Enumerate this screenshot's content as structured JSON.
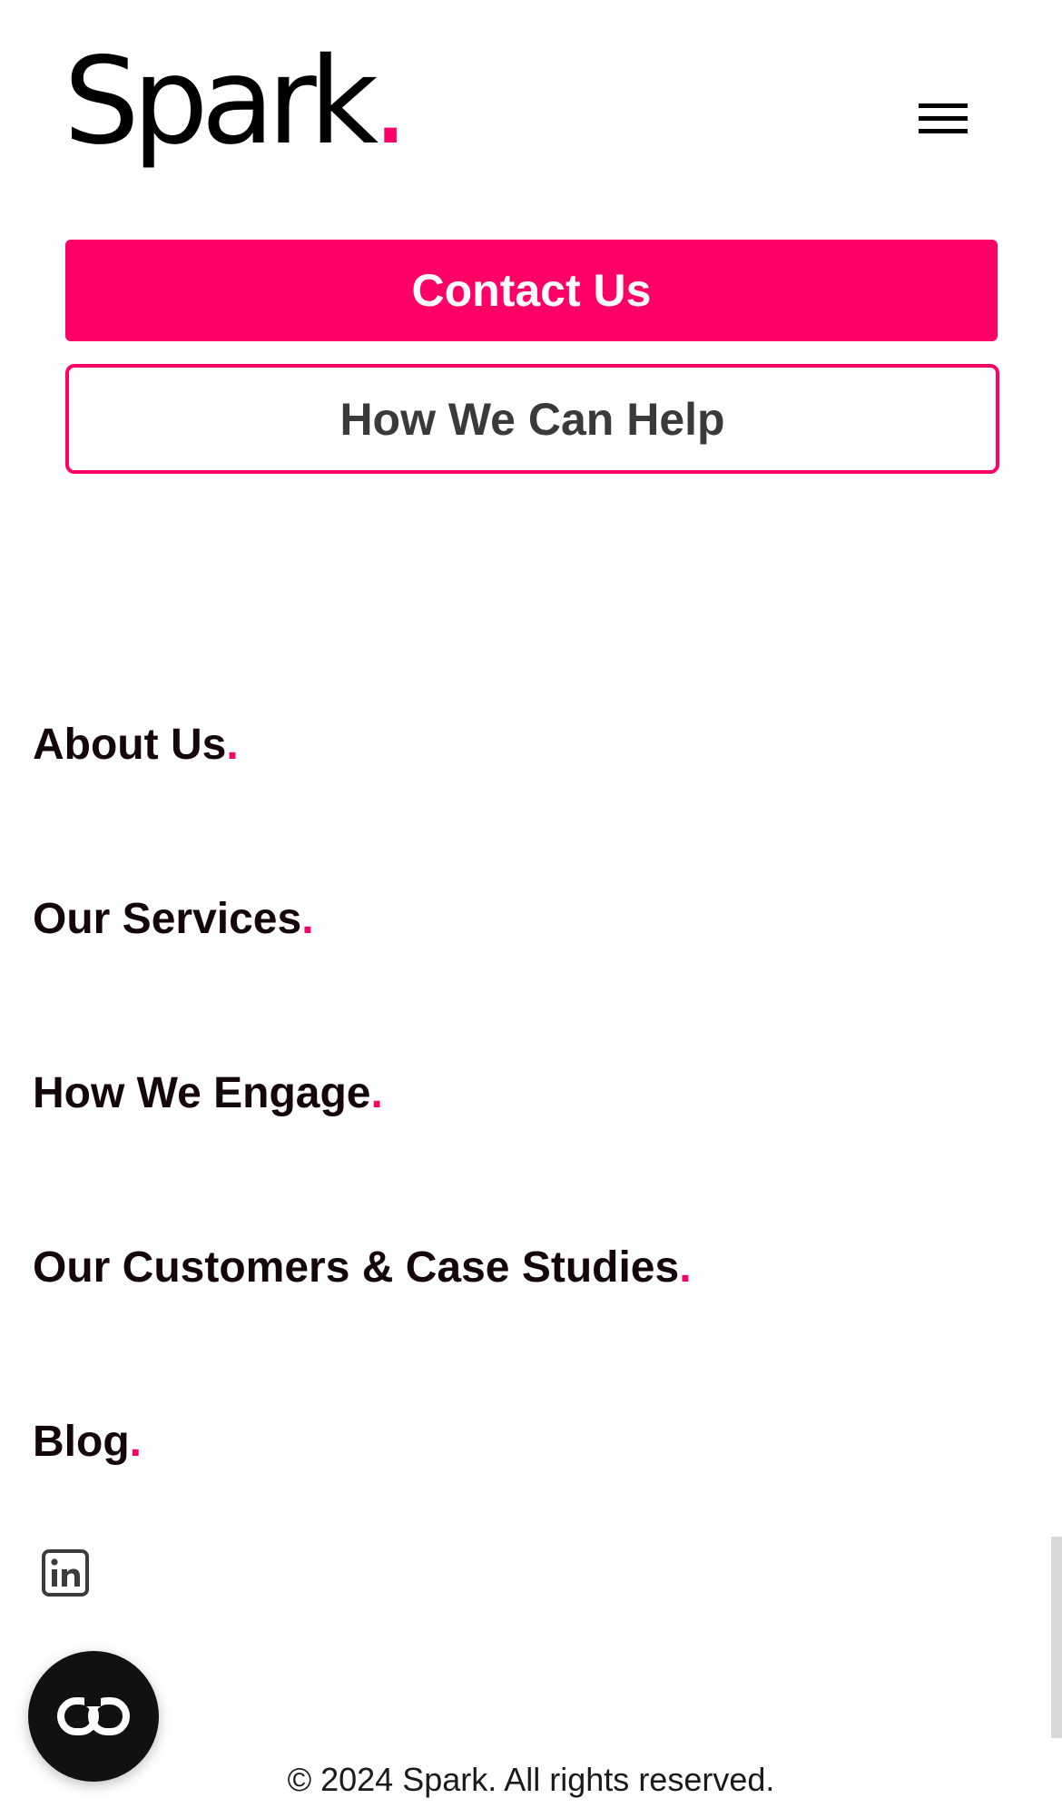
{
  "header": {
    "logo_text": "Spark",
    "logo_dot": ".",
    "menu_icon": "hamburger-menu-icon"
  },
  "cta": {
    "contact_label": "Contact Us",
    "help_label": "How We Can Help"
  },
  "nav": {
    "items": [
      {
        "label": "About Us",
        "dot": "."
      },
      {
        "label": "Our Services",
        "dot": "."
      },
      {
        "label": "How We Engage",
        "dot": "."
      },
      {
        "label": "Our Customers & Case Studies",
        "dot": "."
      },
      {
        "label": "Blog",
        "dot": "."
      }
    ]
  },
  "social": {
    "linkedin_icon": "linkedin-icon"
  },
  "widget": {
    "icon": "chat-widget-icon"
  },
  "footer": {
    "copyright": "© 2024 Spark. All rights reserved."
  },
  "colors": {
    "accent": "#ff0066",
    "text": "#14060c",
    "background": "#ffffff"
  }
}
